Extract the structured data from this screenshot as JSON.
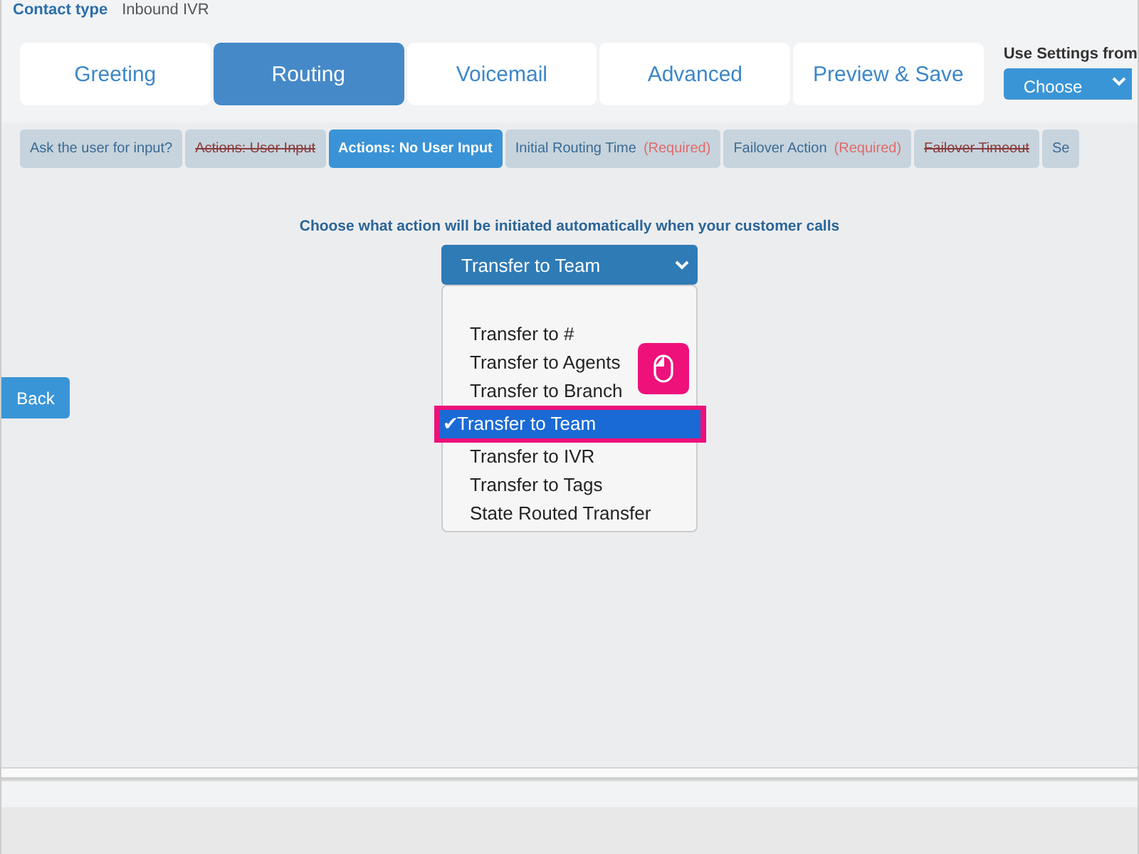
{
  "header": {
    "label": "Contact type",
    "value": "Inbound IVR"
  },
  "tabs": [
    {
      "label": "Greeting",
      "selected": false
    },
    {
      "label": "Routing",
      "selected": true
    },
    {
      "label": "Voicemail",
      "selected": false
    },
    {
      "label": "Advanced",
      "selected": false
    },
    {
      "label": "Preview & Save",
      "selected": false
    }
  ],
  "settings": {
    "label": "Use Settings from",
    "button": "Choose"
  },
  "subtabs": [
    {
      "label": "Ask the user for input?",
      "selected": false,
      "struck": false
    },
    {
      "label": "Actions: User Input",
      "selected": false,
      "struck": true
    },
    {
      "label": "Actions: No User Input",
      "selected": true,
      "struck": false
    },
    {
      "label": "Initial Routing Time",
      "note": "(Required)",
      "selected": false,
      "struck": false
    },
    {
      "label": "Failover Action",
      "note": "(Required)",
      "selected": false,
      "struck": false
    },
    {
      "label": "Failover Timeout",
      "selected": false,
      "struck": true
    },
    {
      "label": "Se",
      "selected": false,
      "struck": false
    }
  ],
  "prompt": "Choose what action will be initiated automatically when your customer calls",
  "select": {
    "value": "Transfer to Team",
    "expanded": true,
    "options": [
      {
        "label": "Transfer to #",
        "selected": false
      },
      {
        "label": "Transfer to Agents",
        "selected": false
      },
      {
        "label": "Transfer to Branch",
        "selected": false
      },
      {
        "label": "Transfer to Team",
        "selected": true
      },
      {
        "label": "Transfer to IVR",
        "selected": false
      },
      {
        "label": "Transfer to Tags",
        "selected": false
      },
      {
        "label": "State Routed Transfer",
        "selected": false
      }
    ]
  },
  "check": "✔",
  "back_button": "Back"
}
